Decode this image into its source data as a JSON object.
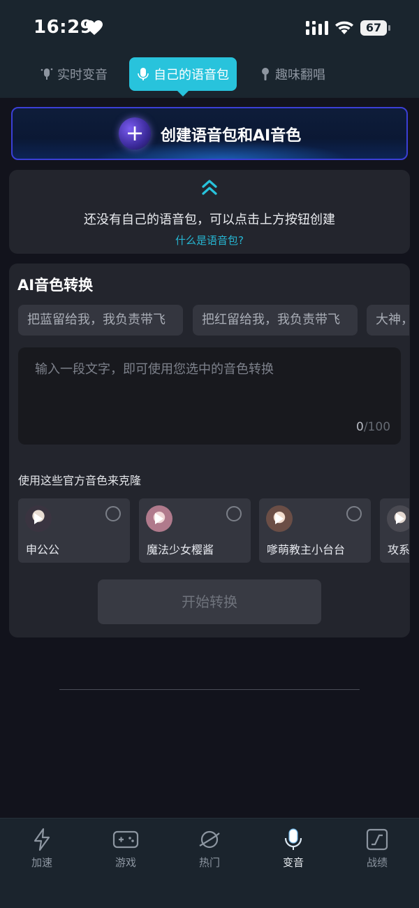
{
  "status_bar": {
    "time": "16:29",
    "battery": "67"
  },
  "tabs": [
    {
      "label": "实时变音",
      "active": false
    },
    {
      "label": "自己的语音包",
      "active": true
    },
    {
      "label": "趣味翻唱",
      "active": false
    }
  ],
  "banner": {
    "label": "创建语音包和AI音色"
  },
  "empty_state": {
    "message": "还没有自己的语音包，可以点击上方按钮创建",
    "link": "什么是语音包?"
  },
  "ai_convert": {
    "title": "AI音色转换",
    "chips": [
      "把蓝留给我，我负责带飞",
      "把红留给我，我负责带飞",
      "大神，"
    ],
    "input_placeholder": "输入一段文字，即可使用您选中的音色转换",
    "counter_current": "0",
    "counter_max": "/100",
    "clone_label": "使用这些官方音色来克隆",
    "voices": [
      {
        "name": "申公公",
        "avatar_color": "#3a3440"
      },
      {
        "name": "魔法少女樱酱",
        "avatar_color": "#b07a8c"
      },
      {
        "name": "嗲萌教主小台台",
        "avatar_color": "#6b4e46"
      },
      {
        "name": "攻系",
        "avatar_color": "#4a4a52"
      }
    ],
    "start_button": "开始转换"
  },
  "bottom_nav": [
    {
      "label": "加速",
      "icon": "lightning-icon",
      "active": false
    },
    {
      "label": "游戏",
      "icon": "gamepad-icon",
      "active": false
    },
    {
      "label": "热门",
      "icon": "planet-icon",
      "active": false
    },
    {
      "label": "变音",
      "icon": "microphone-icon",
      "active": true
    },
    {
      "label": "战绩",
      "icon": "chart-icon",
      "active": false
    }
  ],
  "colors": {
    "accent": "#28c3dc",
    "banner_border": "#3b3fd6",
    "link": "#26b6d2"
  }
}
